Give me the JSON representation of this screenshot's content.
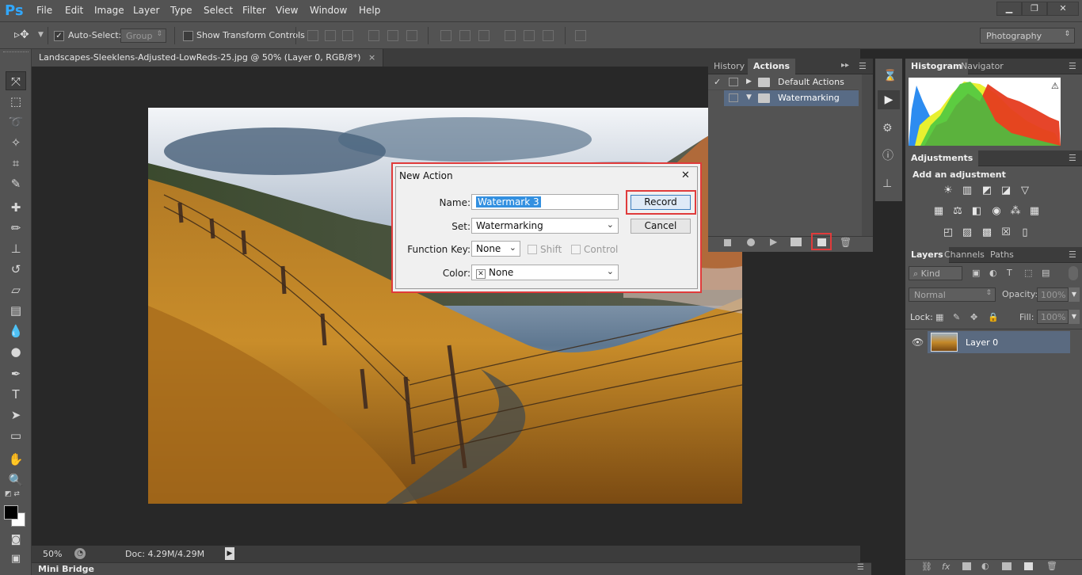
{
  "app": {
    "logo": "Ps"
  },
  "menu": [
    "File",
    "Edit",
    "Image",
    "Layer",
    "Type",
    "Select",
    "Filter",
    "View",
    "Window",
    "Help"
  ],
  "window_controls": [
    "minimize-icon",
    "restore-icon",
    "close-icon"
  ],
  "options": {
    "auto_select_label": "Auto-Select:",
    "auto_select_checked": true,
    "group_value": "Group",
    "show_transform_label": "Show Transform Controls",
    "workspace": "Photography"
  },
  "document": {
    "tab_title": "Landscapes-Sleeklens-Adjusted-LowReds-25.jpg @ 50% (Layer 0, RGB/8*)",
    "tab_close": "×"
  },
  "status": {
    "zoom": "50%",
    "doc": "Doc: 4.29M/4.29M"
  },
  "mini_bridge": "Mini Bridge",
  "actions_panel": {
    "tabs": [
      "History",
      "Actions"
    ],
    "active_tab": "Actions",
    "items": [
      {
        "label": "Default Actions",
        "checked": true,
        "expanded": false
      },
      {
        "label": "Watermarking",
        "checked": false,
        "expanded": true
      }
    ]
  },
  "histogram_panel": {
    "tabs": [
      "Histogram",
      "Navigator"
    ],
    "warning": "⚠"
  },
  "adjustments_panel": {
    "title": "Adjustments",
    "subtitle": "Add an adjustment"
  },
  "layers_panel": {
    "tabs": [
      "Layers",
      "Channels",
      "Paths"
    ],
    "kind": "Kind",
    "blend": "Normal",
    "opacity_label": "Opacity:",
    "opacity_value": "100%",
    "lock_label": "Lock:",
    "fill_label": "Fill:",
    "fill_value": "100%",
    "layers": [
      {
        "name": "Layer 0",
        "visible": true
      }
    ]
  },
  "dialog": {
    "title": "New Action",
    "close": "✕",
    "name_label": "Name:",
    "name_value": "Watermark 3",
    "set_label": "Set:",
    "set_value": "Watermarking",
    "fkey_label": "Function Key:",
    "fkey_value": "None",
    "shift_label": "Shift",
    "control_label": "Control",
    "color_label": "Color:",
    "color_value": "None",
    "color_x": "✕",
    "record_label": "Record",
    "cancel_label": "Cancel"
  },
  "colors": {
    "highlight": "#e03b3b",
    "selection": "#3390e0",
    "ui_bg": "#535353"
  }
}
